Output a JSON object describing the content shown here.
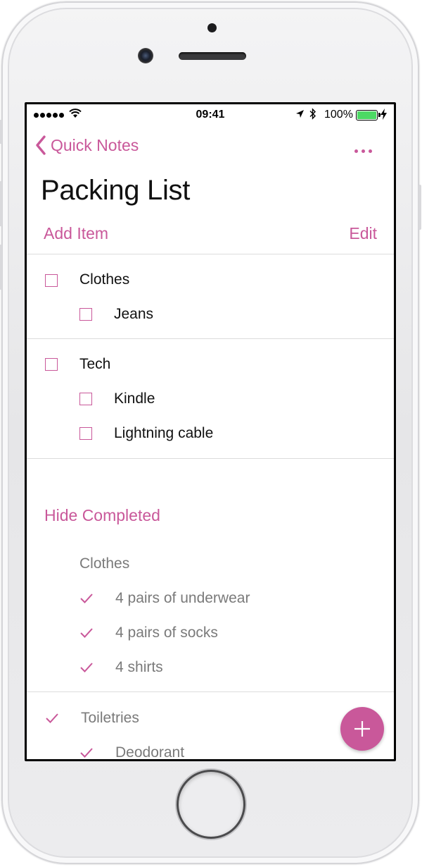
{
  "status_bar": {
    "time": "09:41",
    "battery_percent": "100%",
    "signal_bars": 5,
    "icons": [
      "signal-icon",
      "wifi-icon",
      "location-arrow-icon",
      "bluetooth-icon",
      "battery-icon",
      "charging-bolt-icon"
    ]
  },
  "nav": {
    "back_label": "Quick Notes",
    "back_icon": "chevron-left-icon",
    "more_icon": "more-dots-icon"
  },
  "page": {
    "title": "Packing List",
    "add_item_label": "Add Item",
    "edit_label": "Edit"
  },
  "open_groups": [
    {
      "label": "Clothes",
      "items": [
        {
          "label": "Jeans"
        }
      ]
    },
    {
      "label": "Tech",
      "items": [
        {
          "label": "Kindle"
        },
        {
          "label": "Lightning cable"
        }
      ]
    }
  ],
  "completed_section": {
    "toggle_label": "Hide Completed",
    "groups": [
      {
        "label": "Clothes",
        "checked": false,
        "items": [
          {
            "label": "4 pairs of underwear"
          },
          {
            "label": "4 pairs of socks"
          },
          {
            "label": "4 shirts"
          }
        ]
      },
      {
        "label": "Toiletries",
        "checked": true,
        "items": [
          {
            "label": "Deodorant"
          }
        ]
      }
    ]
  },
  "fab_icon": "plus-icon",
  "colors": {
    "accent": "#c9589a",
    "battery": "#4cd964",
    "completed_text": "#7a7a7a"
  }
}
